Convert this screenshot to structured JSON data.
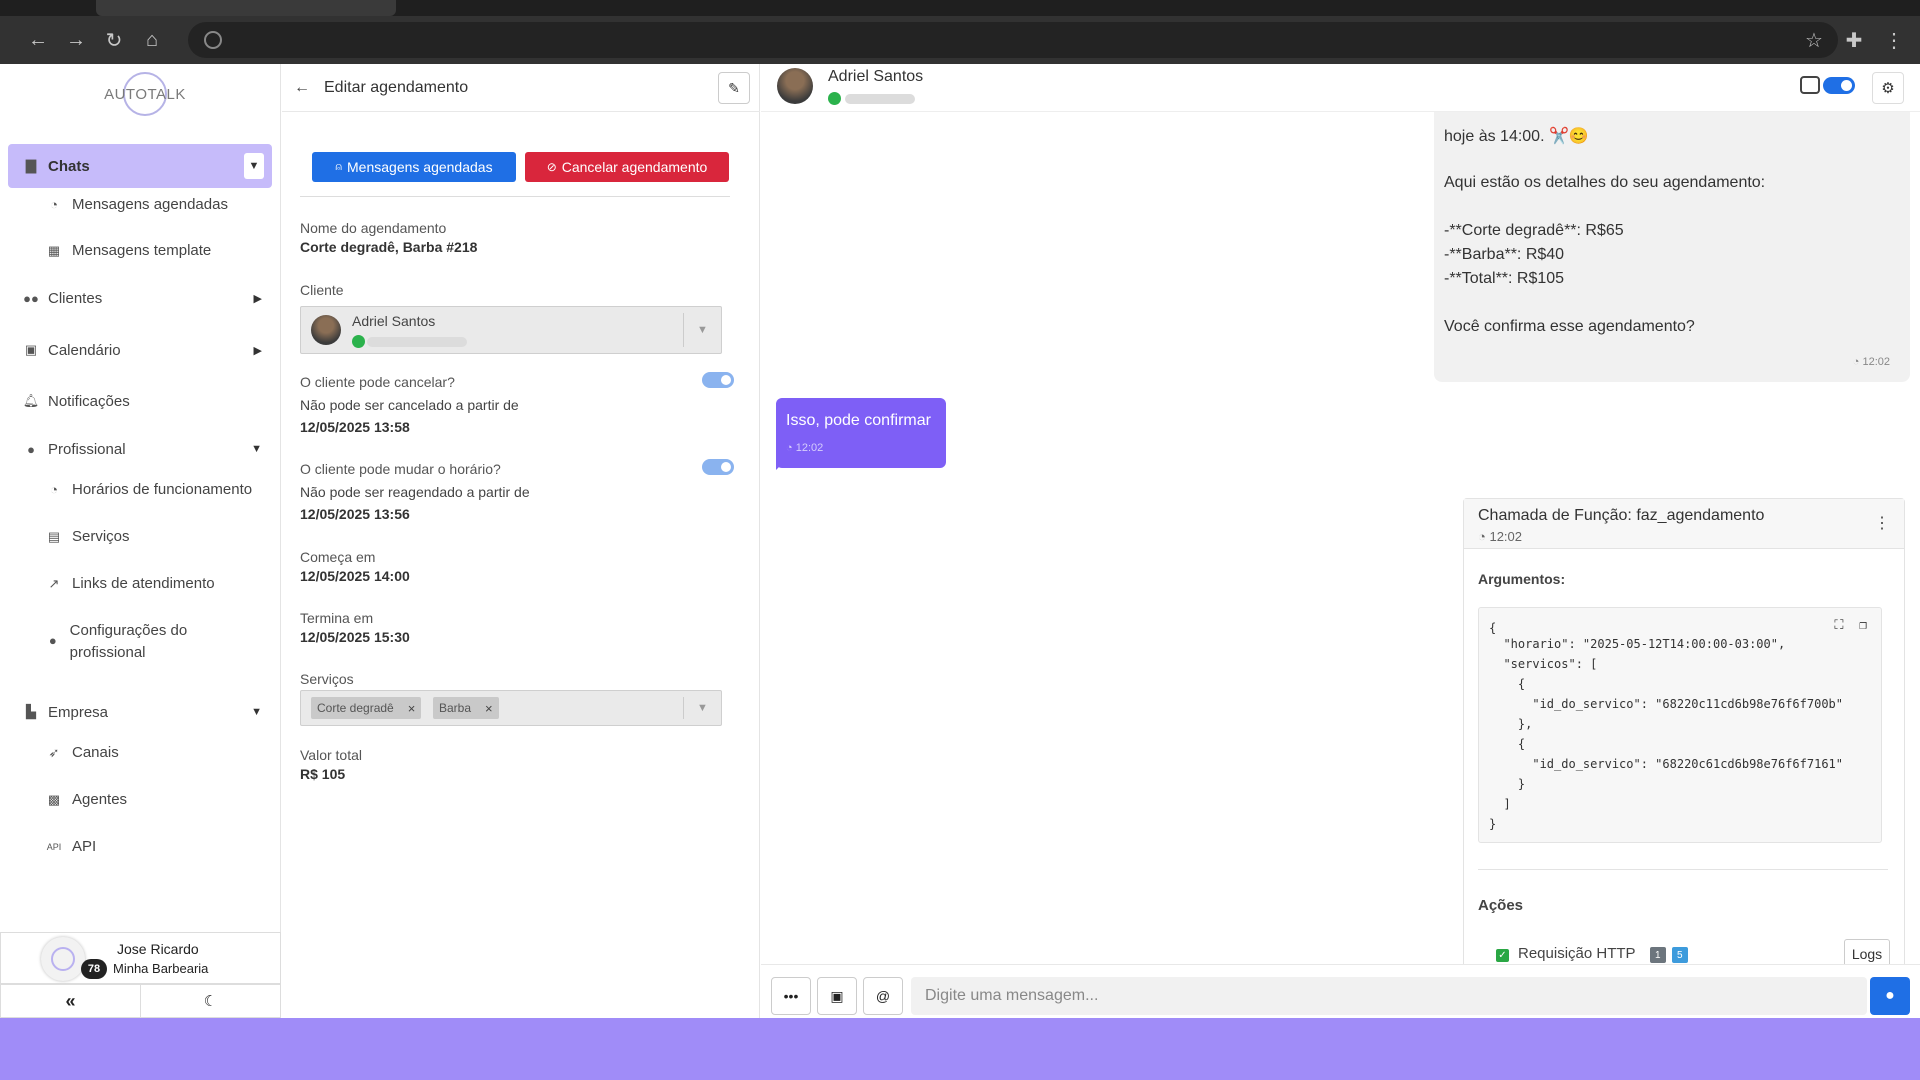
{
  "browser": {
    "back": "←",
    "forward": "→",
    "reload": "↻",
    "home": "⌂",
    "star": "☆",
    "extensions": "✚",
    "menu": "⋮"
  },
  "colors": {
    "accent": "#7e5ff6",
    "primary": "#1f6fe5",
    "danger": "#d9263c",
    "whatsapp": "#2bb24c",
    "page_bg": "#a08cf8"
  },
  "sidebar": {
    "logo": "AUTOTALK",
    "chats": {
      "icon": "chat-icon",
      "label": "Chats"
    },
    "chats_sub": [
      {
        "icon": "clock-icon",
        "label": "Mensagens agendadas"
      },
      {
        "icon": "template-icon",
        "label": "Mensagens template"
      }
    ],
    "clientes": {
      "icon": "users-icon",
      "label": "Clientes"
    },
    "calendario": {
      "icon": "calendar-icon",
      "label": "Calendário"
    },
    "notificacoes": {
      "icon": "bell-icon",
      "label": "Notificações"
    },
    "profissional": {
      "icon": "user-gear-icon",
      "label": "Profissional"
    },
    "profissional_sub": [
      {
        "icon": "clock-icon",
        "label": "Horários de funcionamento"
      },
      {
        "icon": "clipboard-icon",
        "label": "Serviços"
      },
      {
        "icon": "external-link-icon",
        "label": "Links de atendimento"
      },
      {
        "icon": "user-gear-icon",
        "label": "Configurações do profissional"
      }
    ],
    "empresa": {
      "icon": "building-icon",
      "label": "Empresa"
    },
    "empresa_sub": [
      {
        "icon": "rocket-icon",
        "label": "Canais"
      },
      {
        "icon": "robot-icon",
        "label": "Agentes"
      },
      {
        "icon": "api-icon",
        "label": "API"
      }
    ],
    "user": {
      "name": "Jose Ricardo",
      "org": "Minha Barbearia",
      "badge": "78"
    },
    "collapse_icon": "«",
    "theme_icon": "☾"
  },
  "edit_panel": {
    "title": "Editar agendamento",
    "btn_scheduled": "Mensagens agendadas",
    "btn_cancel": "Cancelar agendamento",
    "name_label": "Nome do agendamento",
    "name_value": "Corte degradê, Barba #218",
    "client_label": "Cliente",
    "client_name": "Adriel Santos",
    "can_cancel_label": "O cliente pode cancelar?",
    "can_cancel": true,
    "cancel_note_1": "Não pode ser cancelado a partir de",
    "cancel_note_2": "12/05/2025 13:58",
    "can_change_label": "O cliente pode mudar o horário?",
    "can_change": true,
    "change_note_1": "Não pode ser reagendado a partir de",
    "change_note_2": "12/05/2025 13:56",
    "start_label": "Começa em",
    "start_value": "12/05/2025 14:00",
    "end_label": "Termina em",
    "end_value": "12/05/2025 15:30",
    "services_label": "Serviços",
    "services": [
      "Corte degradê",
      "Barba"
    ],
    "total_label": "Valor total",
    "total_value": "R$ 105"
  },
  "chat": {
    "contact_name": "Adriel Santos",
    "bot_enabled": true,
    "outgoing": {
      "lines": [
        "hoje às 14:00. ✂️😊",
        "",
        "Aqui estão os detalhes do seu agendamento:",
        "",
        "-**Corte degradê**: R$65",
        "-**Barba**: R$40",
        "-**Total**: R$105",
        "",
        "Você confirma esse agendamento?"
      ],
      "time": "12:02"
    },
    "incoming": {
      "text": "Isso, pode confirmar",
      "time": "12:02"
    },
    "function_call": {
      "title": "Chamada de Função: faz_agendamento",
      "time": "12:02",
      "args_label": "Argumentos:",
      "code_lines": [
        "{",
        "  \"horario\": \"2025-05-12T14:00:00-03:00\",",
        "  \"servicos\": [",
        "    {",
        "      \"id_do_servico\": \"68220c11cd6b98e76f6f700b\"",
        "    },",
        "    {",
        "      \"id_do_servico\": \"68220c61cd6b98e76f6f7161\"",
        "    }",
        "  ]",
        "}"
      ],
      "actions_label": "Ações",
      "action_name": "Requisição HTTP",
      "action_count_a": "1",
      "action_count_b": "5",
      "logs_label": "Logs"
    },
    "composer_placeholder": "Digite uma mensagem..."
  }
}
